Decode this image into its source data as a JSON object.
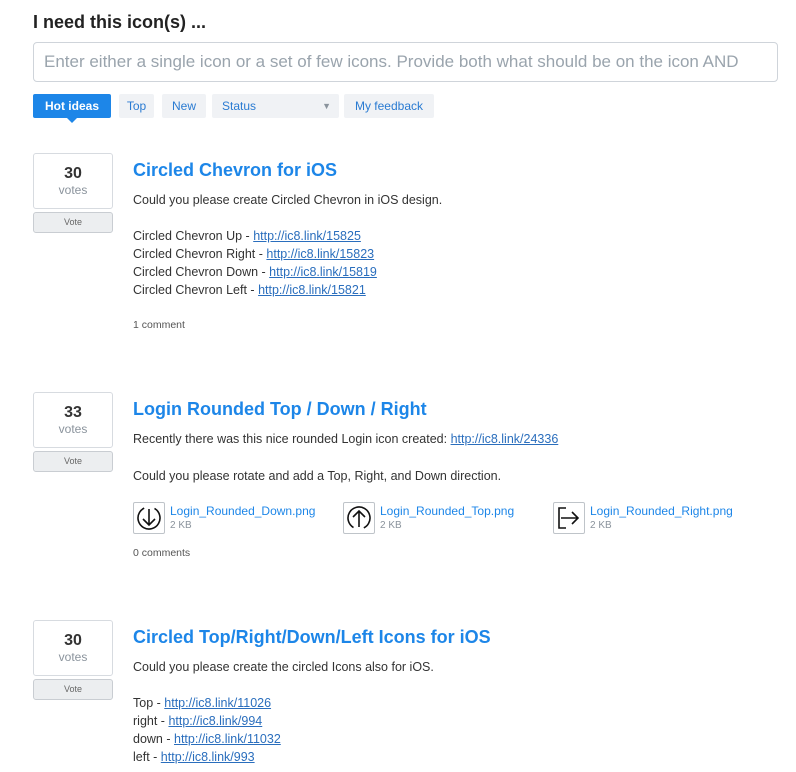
{
  "heading": "I need this icon(s) ...",
  "search": {
    "placeholder": "Enter either a single icon or a set of few icons. Provide both what should be on the icon AND"
  },
  "tabs": {
    "hot": "Hot ideas",
    "top": "Top",
    "new": "New",
    "status": "Status",
    "feedback": "My feedback"
  },
  "ideas": [
    {
      "votes": "30",
      "votes_label": "votes",
      "vote_button": "Vote",
      "title": "Circled Chevron for iOS",
      "intro": "Could you please create Circled Chevron in iOS design.",
      "lines": [
        {
          "text": "Circled Chevron Up - ",
          "link": "http://ic8.link/15825"
        },
        {
          "text": "Circled Chevron Right - ",
          "link": "http://ic8.link/15823"
        },
        {
          "text": "Circled Chevron Down - ",
          "link": "http://ic8.link/15819"
        },
        {
          "text": "Circled Chevron Left - ",
          "link": "http://ic8.link/15821"
        }
      ],
      "comments": "1 comment"
    },
    {
      "votes": "33",
      "votes_label": "votes",
      "vote_button": "Vote",
      "title": "Login Rounded Top / Down / Right",
      "intro_text": "Recently there was this nice rounded Login icon created: ",
      "intro_link": "http://ic8.link/24336",
      "second": "Could you please rotate and add a Top, Right, and Down direction.",
      "attachments": [
        {
          "name": "Login_Rounded_Down.png",
          "size": "2 KB",
          "icon": "arrow-down-icon"
        },
        {
          "name": "Login_Rounded_Top.png",
          "size": "2 KB",
          "icon": "arrow-up-icon"
        },
        {
          "name": "Login_Rounded_Right.png",
          "size": "2 KB",
          "icon": "arrow-right-icon"
        }
      ],
      "comments": "0 comments"
    },
    {
      "votes": "30",
      "votes_label": "votes",
      "vote_button": "Vote",
      "title": "Circled Top/Right/Down/Left Icons for iOS",
      "intro": "Could you please create the circled Icons also for iOS.",
      "lines": [
        {
          "text": "Top - ",
          "link": "http://ic8.link/11026"
        },
        {
          "text": "right - ",
          "link": "http://ic8.link/994"
        },
        {
          "text": "down - ",
          "link": "http://ic8.link/11032"
        },
        {
          "text": "left - ",
          "link": "http://ic8.link/993"
        }
      ]
    }
  ],
  "colors": {
    "accent": "#1d86e8",
    "link": "#2a6ebd",
    "tab_bg": "#f0f2f5"
  }
}
